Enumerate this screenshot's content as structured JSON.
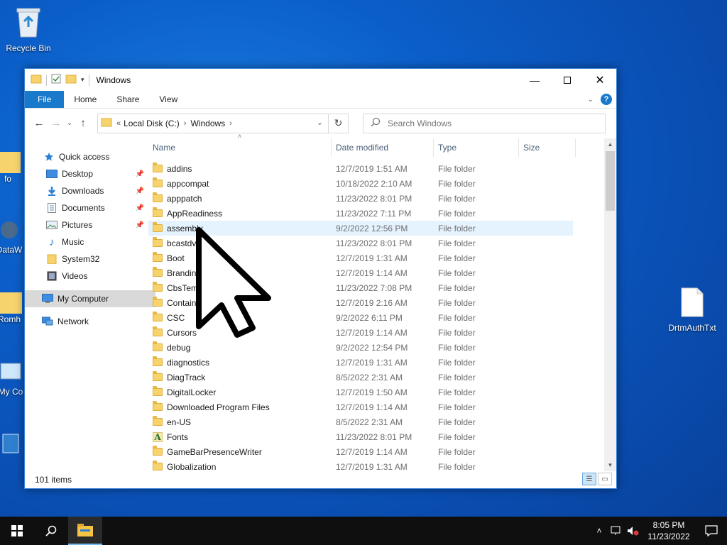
{
  "desktop": {
    "icons": [
      {
        "label": "Recycle Bin"
      },
      {
        "label": "fo"
      },
      {
        "label": "DataW"
      },
      {
        "label": "Romh"
      },
      {
        "label": "My Co"
      },
      {
        "label": "DrtmAuthTxt"
      }
    ]
  },
  "window": {
    "title": "Windows",
    "ribbon_tabs": [
      "File",
      "Home",
      "Share",
      "View"
    ],
    "help": "?",
    "address": {
      "prefix": "«",
      "crumbs": [
        "Local Disk (C:)",
        "Windows"
      ]
    },
    "search": {
      "placeholder": "Search Windows"
    },
    "nav_pane": [
      {
        "label": "Quick access",
        "icon": "star-icon"
      },
      {
        "label": "Desktop",
        "icon": "desktop-icon",
        "pinned": true
      },
      {
        "label": "Downloads",
        "icon": "download-icon",
        "pinned": true
      },
      {
        "label": "Documents",
        "icon": "documents-icon",
        "pinned": true
      },
      {
        "label": "Pictures",
        "icon": "pictures-icon",
        "pinned": true
      },
      {
        "label": "Music",
        "icon": "music-icon"
      },
      {
        "label": "System32",
        "icon": "folder-icon"
      },
      {
        "label": "Videos",
        "icon": "videos-icon"
      },
      {
        "label": "My Computer",
        "icon": "computer-icon",
        "selected": true
      },
      {
        "label": "Network",
        "icon": "network-icon"
      }
    ],
    "columns": [
      "Name",
      "Date modified",
      "Type",
      "Size"
    ],
    "files": [
      {
        "name": "addins",
        "date": "12/7/2019 1:51 AM",
        "type": "File folder"
      },
      {
        "name": "appcompat",
        "date": "10/18/2022 2:10 AM",
        "type": "File folder"
      },
      {
        "name": "apppatch",
        "date": "11/23/2022 8:01 PM",
        "type": "File folder"
      },
      {
        "name": "AppReadiness",
        "date": "11/23/2022 7:11 PM",
        "type": "File folder"
      },
      {
        "name": "assembly",
        "date": "9/2/2022 12:56 PM",
        "type": "File folder",
        "hover": true
      },
      {
        "name": "bcastdvr",
        "date": "11/23/2022 8:01 PM",
        "type": "File folder"
      },
      {
        "name": "Boot",
        "date": "12/7/2019 1:31 AM",
        "type": "File folder"
      },
      {
        "name": "Branding",
        "date": "12/7/2019 1:14 AM",
        "type": "File folder"
      },
      {
        "name": "CbsTemp",
        "date": "11/23/2022 7:08 PM",
        "type": "File folder"
      },
      {
        "name": "Containe",
        "date": "12/7/2019 2:16 AM",
        "type": "File folder"
      },
      {
        "name": "CSC",
        "date": "9/2/2022 6:11 PM",
        "type": "File folder"
      },
      {
        "name": "Cursors",
        "date": "12/7/2019 1:14 AM",
        "type": "File folder"
      },
      {
        "name": "debug",
        "date": "9/2/2022 12:54 PM",
        "type": "File folder"
      },
      {
        "name": "diagnostics",
        "date": "12/7/2019 1:31 AM",
        "type": "File folder"
      },
      {
        "name": "DiagTrack",
        "date": "8/5/2022 2:31 AM",
        "type": "File folder"
      },
      {
        "name": "DigitalLocker",
        "date": "12/7/2019 1:50 AM",
        "type": "File folder"
      },
      {
        "name": "Downloaded Program Files",
        "date": "12/7/2019 1:14 AM",
        "type": "File folder"
      },
      {
        "name": "en-US",
        "date": "8/5/2022 2:31 AM",
        "type": "File folder"
      },
      {
        "name": "Fonts",
        "date": "11/23/2022 8:01 PM",
        "type": "File folder",
        "special": "fonts"
      },
      {
        "name": "GameBarPresenceWriter",
        "date": "12/7/2019 1:14 AM",
        "type": "File folder"
      },
      {
        "name": "Globalization",
        "date": "12/7/2019 1:31 AM",
        "type": "File folder"
      }
    ],
    "status": "101 items"
  },
  "taskbar": {
    "time": "8:05 PM",
    "date": "11/23/2022"
  },
  "colors": {
    "accent": "#1979ca",
    "desktop": "#0b5ec9",
    "selection": "#e5f3ff"
  }
}
